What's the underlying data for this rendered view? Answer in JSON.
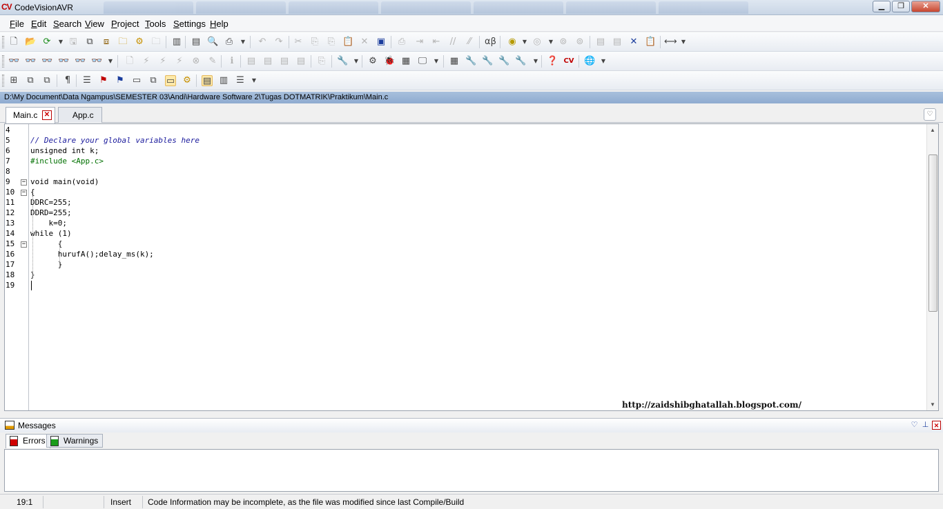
{
  "window": {
    "title": "CodeVisionAVR",
    "logo_text": "CV"
  },
  "menu": [
    {
      "key": "F",
      "rest": "ile"
    },
    {
      "key": "E",
      "rest": "dit"
    },
    {
      "key": "S",
      "rest": "earch"
    },
    {
      "key": "V",
      "rest": "iew"
    },
    {
      "key": "P",
      "rest": "roject"
    },
    {
      "key": "T",
      "rest": "ools"
    },
    {
      "key": "S",
      "rest": "ettings"
    },
    {
      "key": "H",
      "rest": "elp"
    }
  ],
  "path": "D:\\My Document\\Data Ngampus\\SEMESTER 03\\Andi\\Hardware Software 2\\Tugas DOTMATRIK\\Praktikum\\Main.c",
  "tabs": [
    {
      "label": "Main.c",
      "active": true
    },
    {
      "label": "App.c",
      "active": false
    }
  ],
  "editor": {
    "line_numbers": [
      "4",
      "5",
      "6",
      "7",
      "8",
      "9",
      "10",
      "11",
      "12",
      "13",
      "14",
      "15",
      "16",
      "17",
      "18",
      "19"
    ],
    "lines": [
      {
        "text": "",
        "kind": "plain"
      },
      {
        "text": "// Declare your global variables here",
        "kind": "comment"
      },
      {
        "text": "unsigned int k;",
        "kind": "plain"
      },
      {
        "text": "#include <App.c>",
        "kind": "directive"
      },
      {
        "text": "",
        "kind": "plain"
      },
      {
        "text": "void main(void)",
        "kind": "plain"
      },
      {
        "text": "{",
        "kind": "plain"
      },
      {
        "text": "DDRC=255;",
        "kind": "plain"
      },
      {
        "text": "DDRD=255;",
        "kind": "plain"
      },
      {
        "text": "    k=0;",
        "kind": "plain"
      },
      {
        "text": "while (1)",
        "kind": "plain"
      },
      {
        "text": "      {",
        "kind": "plain"
      },
      {
        "text": "      hurufA();delay_ms(k);",
        "kind": "plain"
      },
      {
        "text": "      }",
        "kind": "plain"
      },
      {
        "text": "}",
        "kind": "plain"
      },
      {
        "text": "",
        "kind": "plain"
      }
    ],
    "watermark": "http://zaidshibghatallah.blogspot.com/"
  },
  "messages": {
    "title": "Messages",
    "tabs": [
      {
        "label": "Errors",
        "active": true
      },
      {
        "label": "Warnings",
        "active": false
      }
    ]
  },
  "status": {
    "position": "19:1",
    "mode": "Insert",
    "info": "Code Information may be incomplete, as the file was modified since last Compile/Build"
  },
  "colors": {
    "comment": "#1a1a9c",
    "directive": "#007000",
    "path_bar": "#a8c0dc",
    "close_button": "#c8462f"
  }
}
